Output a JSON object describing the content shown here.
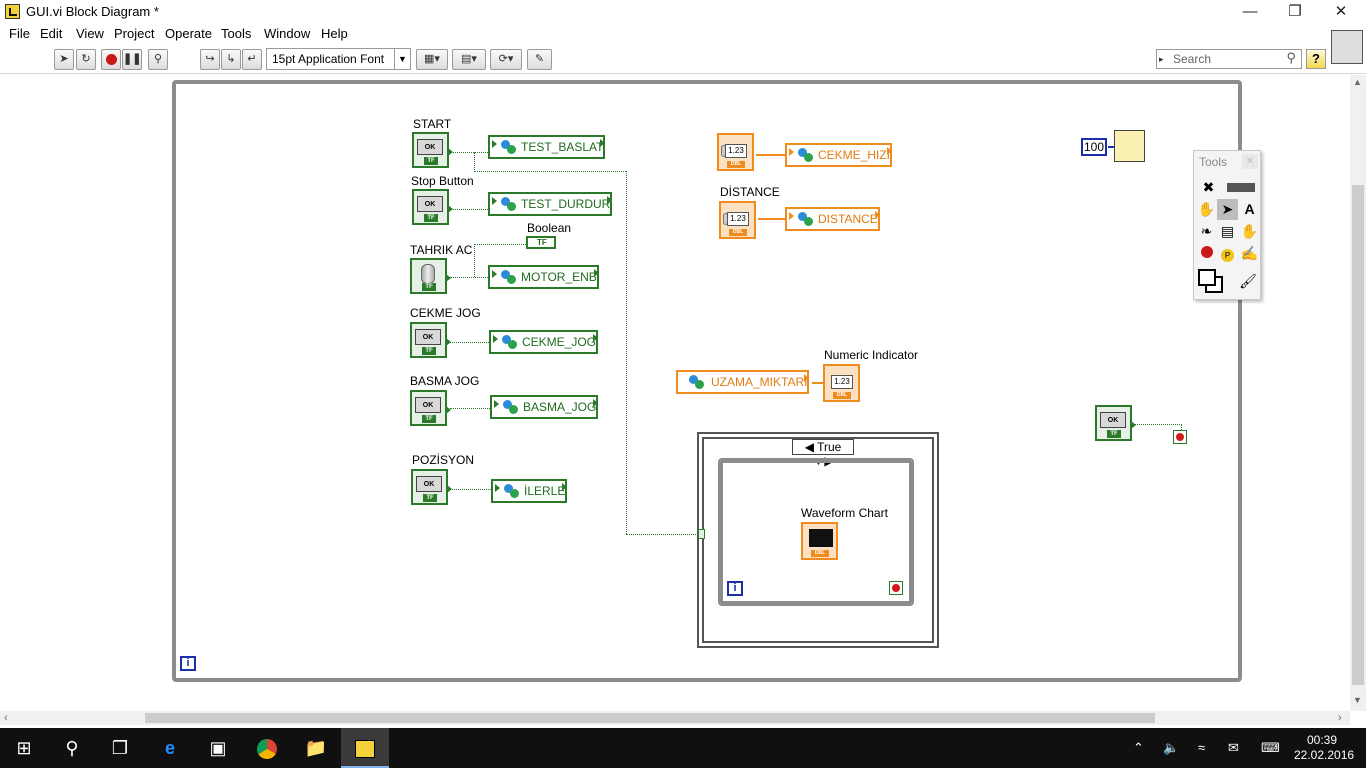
{
  "window": {
    "title": "GUI.vi Block Diagram *",
    "minimize": "—",
    "restore": "❐",
    "close": "✕"
  },
  "menu": [
    "File",
    "Edit",
    "View",
    "Project",
    "Operate",
    "Tools",
    "Window",
    "Help"
  ],
  "toolbar": {
    "font": "15pt Application Font",
    "search_placeholder": "Search",
    "help": "?"
  },
  "diagram": {
    "loop_iteration": "i",
    "labels": {
      "start": "START",
      "stop_button": "Stop Button",
      "tahrik_ac": "TAHRIK AC",
      "boolean": "Boolean",
      "cekme_jog": "CEKME JOG",
      "basma_jog": "BASMA JOG",
      "pozisyon": "POZİSYON",
      "distance": "DİSTANCE",
      "numeric_indicator": "Numeric Indicator",
      "waveform_chart": "Waveform Chart"
    },
    "shared_variables": {
      "test_baslat": "TEST_BASLAT",
      "test_durdur": "TEST_DURDUR",
      "motor_enb": "MOTOR_ENB",
      "cekme_jog": "CEKME_JOG",
      "basma_jog": "BASMA_JOG",
      "ilerle": "İLERLE",
      "cekme_hizi": "CEKME_HIZI",
      "distance": "DISTANCE",
      "uzama_miktari": "UZAMA_MIKTARI"
    },
    "button_face": "OK",
    "tf": "TF",
    "dbl": "DBL",
    "numeric_face": "1.23",
    "constant": "100",
    "case_selector": "True"
  },
  "tools_palette": {
    "title": "Tools"
  },
  "taskbar": {
    "time": "00:39",
    "date": "22.02.2016"
  }
}
